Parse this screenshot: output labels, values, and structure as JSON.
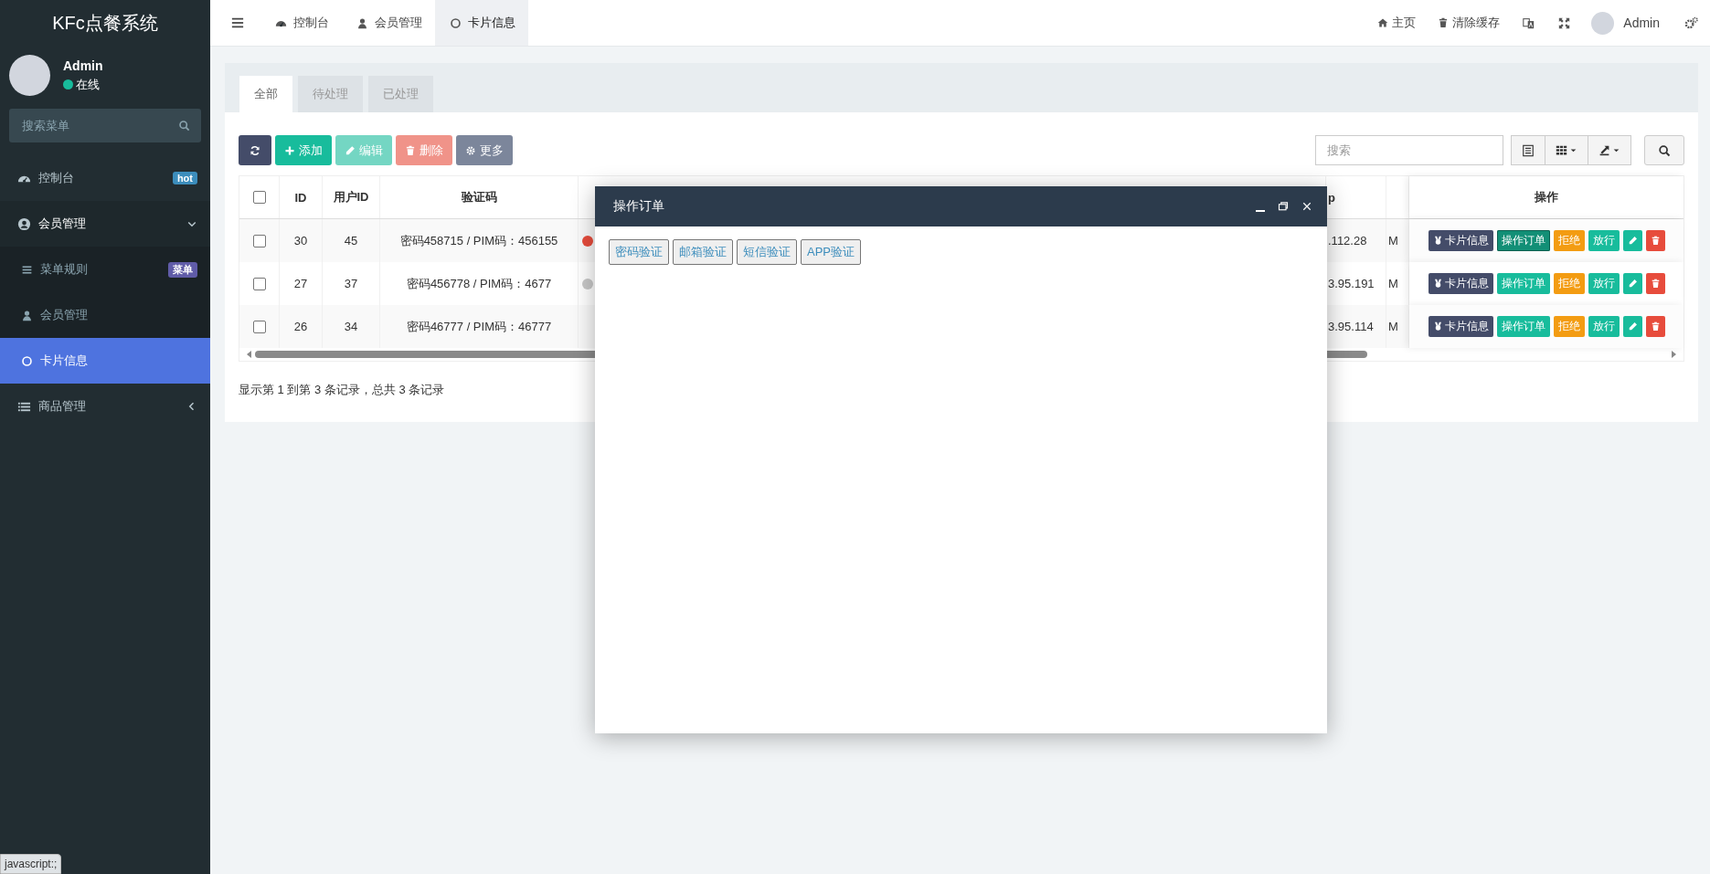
{
  "sidebar": {
    "logo": "KFc点餐系统",
    "user": {
      "name": "Admin",
      "status": "在线"
    },
    "search": {
      "placeholder": "搜索菜单"
    },
    "menu": [
      {
        "label": "控制台",
        "badge": {
          "text": "hot",
          "color": "#3c8dbc"
        }
      },
      {
        "label": "会员管理",
        "expanded": true,
        "children": [
          {
            "label": "菜单规则",
            "badge": {
              "text": "菜单",
              "color": "#605ca8"
            },
            "selected": false
          },
          {
            "label": "会员管理",
            "selected": false
          },
          {
            "label": "卡片信息",
            "selected": true
          }
        ]
      },
      {
        "label": "商品管理",
        "expanded": false
      }
    ]
  },
  "top_nav": {
    "tabs": [
      {
        "label": "控制台",
        "selected": false
      },
      {
        "label": "会员管理",
        "selected": false
      },
      {
        "label": "卡片信息",
        "selected": true
      }
    ],
    "links": [
      "主页",
      "清除缓存"
    ],
    "user": "Admin"
  },
  "content_tabs": [
    {
      "label": "全部",
      "selected": true
    },
    {
      "label": "待处理",
      "selected": false
    },
    {
      "label": "已处理",
      "selected": false
    }
  ],
  "toolbar": {
    "buttons": [
      {
        "kind": "refresh",
        "disabled": false
      },
      {
        "kind": "add",
        "label": "添加",
        "disabled": false
      },
      {
        "kind": "edit",
        "label": "编辑",
        "disabled": true
      },
      {
        "kind": "delete",
        "label": "删除",
        "disabled": true
      },
      {
        "kind": "more",
        "label": "更多",
        "disabled": false
      }
    ],
    "search": {
      "placeholder": "搜索"
    }
  },
  "table": {
    "header_checkbox": {
      "checked": false
    },
    "columns": [
      {
        "label": "ID"
      },
      {
        "label": "用户ID"
      },
      {
        "label": "验证码"
      }
    ],
    "column_9": "p",
    "actions_column": "操作",
    "rows": [
      {
        "checked": false,
        "id": "30",
        "user_id": "45",
        "code": "密码458715 / PIM码：456155",
        "color": "#e74c3c",
        "column_9": ".112.28",
        "column_10": "M",
        "actions": [
          {
            "kind": "card",
            "label": "卡片信息"
          },
          {
            "kind": "order",
            "label": "操作订单",
            "focused": true
          },
          {
            "kind": "reject",
            "label": "拒绝"
          },
          {
            "kind": "pass",
            "label": "放行"
          },
          {
            "kind": "edit"
          },
          {
            "kind": "delete"
          }
        ]
      },
      {
        "checked": false,
        "id": "27",
        "user_id": "37",
        "code": "密码456778 / PIM码：4677",
        "color": "#c8c8c8",
        "column_9": "3.95.191",
        "column_10": "M",
        "actions": [
          {
            "kind": "card",
            "label": "卡片信息"
          },
          {
            "kind": "order",
            "label": "操作订单",
            "focused": false
          },
          {
            "kind": "reject",
            "label": "拒绝"
          },
          {
            "kind": "pass",
            "label": "放行"
          },
          {
            "kind": "edit"
          },
          {
            "kind": "delete"
          }
        ]
      },
      {
        "checked": false,
        "id": "26",
        "user_id": "34",
        "code": "密码46777 / PIM码：46777",
        "column_9": "3.95.114",
        "column_10": "M",
        "actions": [
          {
            "kind": "card",
            "label": "卡片信息"
          },
          {
            "kind": "order",
            "label": "操作订单",
            "focused": false
          },
          {
            "kind": "reject",
            "label": "拒绝"
          },
          {
            "kind": "pass",
            "label": "放行"
          },
          {
            "kind": "edit"
          },
          {
            "kind": "delete"
          }
        ]
      }
    ],
    "footer": "显示第 1 到第 3 条记录，总共 3 条记录"
  },
  "modal": {
    "title": "操作订单",
    "buttons": [
      "密码验证",
      "邮箱验证",
      "短信验证",
      "APP验证"
    ]
  },
  "status_tooltip": "javascript:;"
}
